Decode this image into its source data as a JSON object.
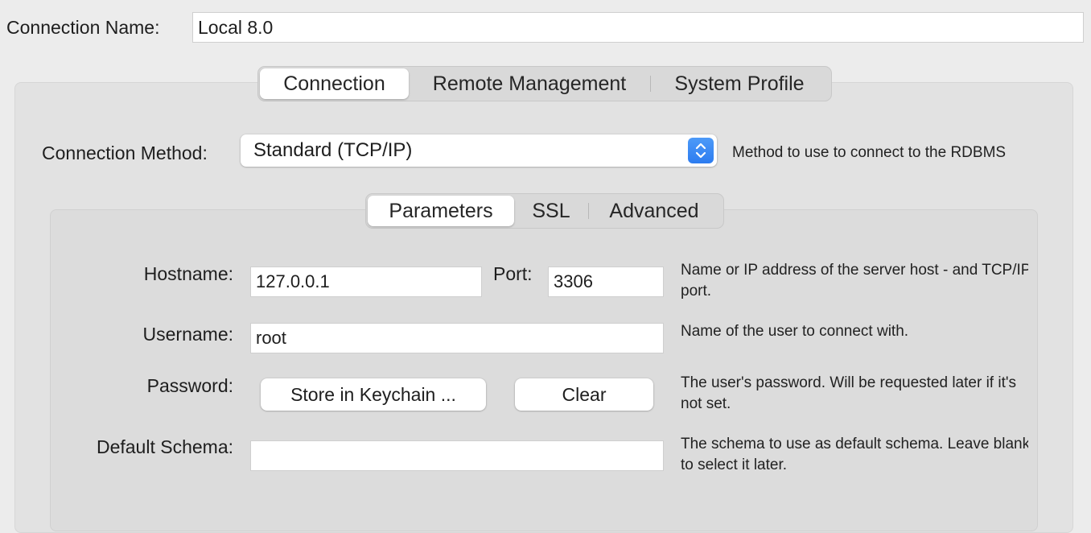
{
  "connection_name": {
    "label": "Connection Name:",
    "value": "Local 8.0"
  },
  "main_tabs": [
    {
      "label": "Connection",
      "active": true
    },
    {
      "label": "Remote Management",
      "active": false
    },
    {
      "label": "System Profile",
      "active": false
    }
  ],
  "connection_method": {
    "label": "Connection Method:",
    "selected": "Standard (TCP/IP)",
    "help": "Method to use to connect to the RDBMS"
  },
  "sub_tabs": [
    {
      "label": "Parameters",
      "active": true
    },
    {
      "label": "SSL",
      "active": false
    },
    {
      "label": "Advanced",
      "active": false
    }
  ],
  "params": {
    "hostname": {
      "label": "Hostname:",
      "value": "127.0.0.1"
    },
    "port": {
      "label": "Port:",
      "value": "3306"
    },
    "host_help_1": "Name or IP address of the server host - and TCP/IP",
    "host_help_2": "port.",
    "username": {
      "label": "Username:",
      "value": "root",
      "help": "Name of the user to connect with."
    },
    "password": {
      "label": "Password:",
      "store_button": "Store in Keychain ...",
      "clear_button": "Clear",
      "help_1": "The user's password. Will be requested later if it's",
      "help_2": "not set."
    },
    "default_schema": {
      "label": "Default Schema:",
      "value": "",
      "help_1": "The schema to use as default schema. Leave blank",
      "help_2": "to select it later."
    }
  },
  "colors": {
    "accent": "#2d7cf0",
    "background": "#ececec"
  }
}
